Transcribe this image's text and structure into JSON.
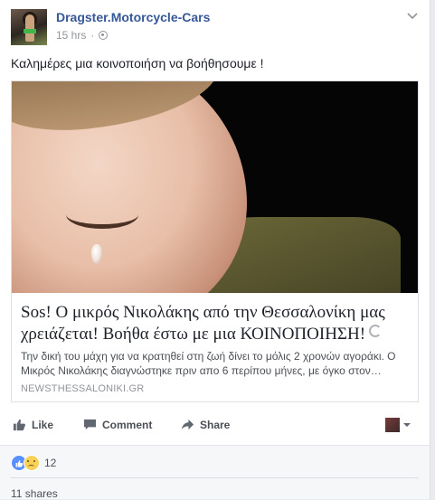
{
  "post": {
    "author": "Dragster.Motorcycle-Cars",
    "timestamp": "15 hrs",
    "separator": "·",
    "privacy_icon": "globe-icon",
    "menu_icon": "chevron-down-icon",
    "text": "Καλημέρες μια κοινοποιήση να βοήθησουμε !"
  },
  "link_card": {
    "headline": "Sos! Ο μικρός Νικολάκης από την Θεσσαλονίκη μας χρειάζεται! Βοήθα έστω με μια ΚΟΙΝΟΠΟΙΗΣΗ!",
    "description": "Την δική του μάχη για να κρατηθεί στη ζωή δίνει το μόλις 2 χρονών αγοράκι. Ο Μικρός Νικολάκης διαγνώστηκε πριν απο 6 περίπου μήνες, με όγκο στον…",
    "domain": "NEWSTHESSALONIKI.GR"
  },
  "actions": {
    "like_label": "Like",
    "comment_label": "Comment",
    "share_label": "Share"
  },
  "footer": {
    "reaction_count": "12",
    "shares_label": "11 shares"
  },
  "colors": {
    "link_blue": "#365899",
    "like_blue": "#5890ff",
    "sad_yellow": "#f7d257"
  }
}
